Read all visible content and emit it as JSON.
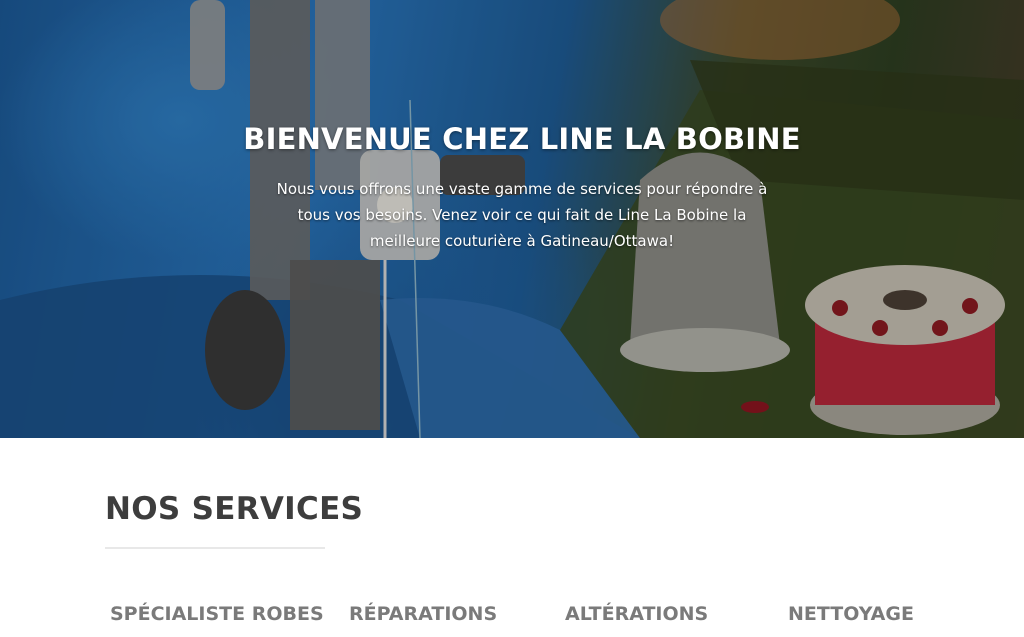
{
  "hero": {
    "title": "BIENVENUE CHEZ LINE LA BOBINE",
    "text": "Nous vous offrons une vaste gamme de services pour répondre à tous vos besoins. Venez voir ce qui fait de Line La Bobine la meilleure couturière à Gatineau/Ottawa!"
  },
  "services": {
    "title": "NOS SERVICES",
    "tabs": [
      {
        "label": "SPÉCIALISTE ROBES"
      },
      {
        "label": "RÉPARATIONS"
      },
      {
        "label": "ALTÉRATIONS"
      },
      {
        "label": "NETTOYAGE"
      }
    ]
  },
  "colors": {
    "heading": "#3d3d3d",
    "tab_text": "#7a7a7a",
    "hero_text": "#ffffff"
  }
}
